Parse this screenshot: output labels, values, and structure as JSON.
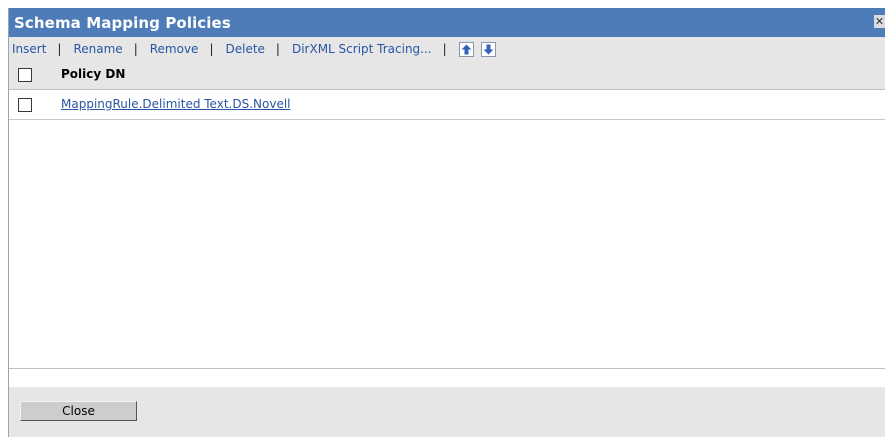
{
  "window": {
    "title": "Schema Mapping Policies",
    "close_glyph": "✕"
  },
  "toolbar": {
    "items": [
      "Insert",
      "Rename",
      "Remove",
      "Delete",
      "DirXML Script Tracing..."
    ],
    "separator": "|",
    "move_up_icon": "arrow-up-icon",
    "move_down_icon": "arrow-down-icon"
  },
  "table": {
    "header": "Policy DN",
    "rows": [
      "MappingRule.Delimited Text.DS.Novell"
    ]
  },
  "footer": {
    "close_label": "Close"
  },
  "colors": {
    "titlebar": "#4d7cb8",
    "toolbar_bg": "#e6e6e6",
    "link": "#2a55a2",
    "arrow": "#2f62b8"
  }
}
